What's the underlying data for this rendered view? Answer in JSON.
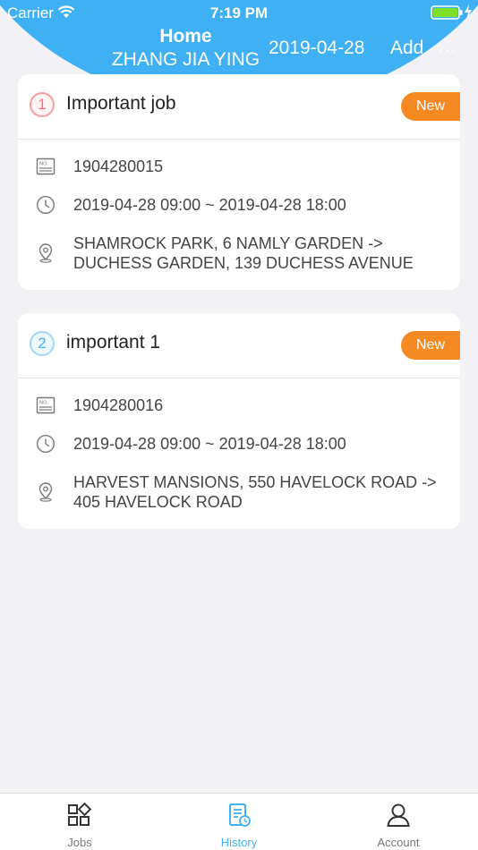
{
  "status": {
    "carrier": "Carrier",
    "time": "7:19 PM"
  },
  "nav": {
    "title": "Home",
    "subtitle": "ZHANG JIA YING",
    "date": "2019-04-28",
    "add": "Add",
    "more": "..."
  },
  "jobs": [
    {
      "index": "1",
      "title": "Important job",
      "badge": "New",
      "number": "1904280015",
      "time": "2019-04-28 09:00 ~ 2019-04-28 18:00",
      "route": "SHAMROCK PARK, 6 NAMLY GARDEN -> DUCHESS GARDEN, 139 DUCHESS AVENUE"
    },
    {
      "index": "2",
      "title": "important 1",
      "badge": "New",
      "number": "1904280016",
      "time": "2019-04-28 09:00 ~ 2019-04-28 18:00",
      "route": "HARVEST MANSIONS, 550 HAVELOCK ROAD -> 405 HAVELOCK ROAD"
    }
  ],
  "tabs": [
    {
      "label": "Jobs",
      "icon": "grid-icon"
    },
    {
      "label": "History",
      "icon": "history-icon",
      "active": true
    },
    {
      "label": "Account",
      "icon": "user-icon"
    }
  ],
  "colors": {
    "accent": "#3fb0f3",
    "badge": "#f58a23",
    "background": "#f2f2f6"
  }
}
